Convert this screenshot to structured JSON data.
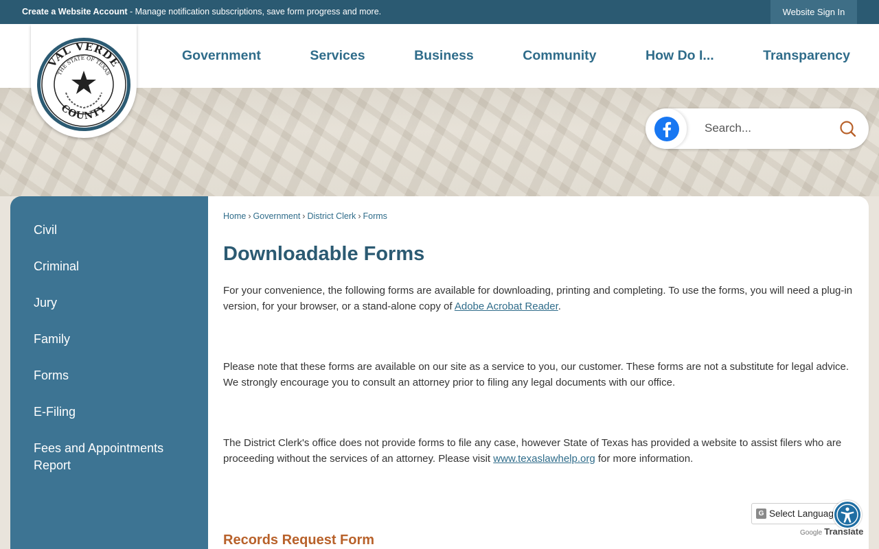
{
  "topbar": {
    "account_link": "Create a Website Account",
    "account_desc": " - Manage notification subscriptions, save form progress and more.",
    "signin": "Website Sign In"
  },
  "seal": {
    "top_text": "VAL VERDE",
    "bottom_text": "COUNTY",
    "inner_text": "THE STATE OF TEXAS"
  },
  "nav": [
    "Government",
    "Services",
    "Business",
    "Community",
    "How Do I...",
    "Transparency"
  ],
  "search": {
    "placeholder": "Search..."
  },
  "sidebar": [
    "Civil",
    "Criminal",
    "Jury",
    "Family",
    "Forms",
    "E-Filing",
    "Fees and Appointments Report"
  ],
  "breadcrumb": [
    "Home",
    "Government",
    "District Clerk",
    "Forms"
  ],
  "main": {
    "title": "Downloadable Forms",
    "p1_text": "For your convenience, the following forms are available for downloading, printing and completing.   To use the forms, you will need a plug-in version, for your browser, or a stand-alone copy of ",
    "p1_link": "Adobe Acrobat Reader",
    "p1_end": ".",
    "p2_text": "Please note that these forms are available on our site as a service to you, our customer.  These forms are not a substitute for legal advice.  We strongly encourage you to consult an attorney prior to filing any legal documents with our office.",
    "p3_text": "The District Clerk's office does not provide forms to file any case, however State of Texas has provided a website to assist filers who are proceeding without the services of an attorney.  Please visit ",
    "p3_link": "www.texaslawhelp.org",
    "p3_end": " for more information.",
    "subhead": "Records Request Form"
  },
  "translate": {
    "label": "Select Language",
    "powered_google": "Google",
    "powered_translate": "Translate"
  },
  "colors": {
    "topbar": "#2b5a72",
    "nav": "#2f6c8a",
    "sidebar": "#3d7493",
    "subhead": "#b8612a"
  }
}
